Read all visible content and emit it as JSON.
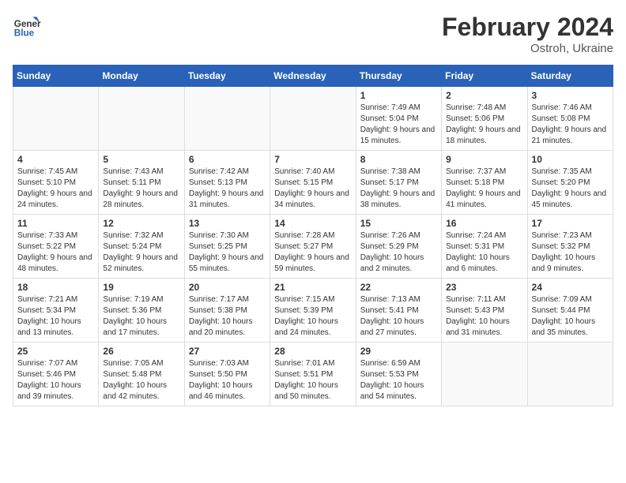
{
  "header": {
    "logo_general": "General",
    "logo_blue": "Blue",
    "month_title": "February 2024",
    "location": "Ostroh, Ukraine"
  },
  "weekdays": [
    "Sunday",
    "Monday",
    "Tuesday",
    "Wednesday",
    "Thursday",
    "Friday",
    "Saturday"
  ],
  "weeks": [
    [
      {
        "day": "",
        "sunrise": "",
        "sunset": "",
        "daylight": ""
      },
      {
        "day": "",
        "sunrise": "",
        "sunset": "",
        "daylight": ""
      },
      {
        "day": "",
        "sunrise": "",
        "sunset": "",
        "daylight": ""
      },
      {
        "day": "",
        "sunrise": "",
        "sunset": "",
        "daylight": ""
      },
      {
        "day": "1",
        "sunrise": "Sunrise: 7:49 AM",
        "sunset": "Sunset: 5:04 PM",
        "daylight": "Daylight: 9 hours and 15 minutes."
      },
      {
        "day": "2",
        "sunrise": "Sunrise: 7:48 AM",
        "sunset": "Sunset: 5:06 PM",
        "daylight": "Daylight: 9 hours and 18 minutes."
      },
      {
        "day": "3",
        "sunrise": "Sunrise: 7:46 AM",
        "sunset": "Sunset: 5:08 PM",
        "daylight": "Daylight: 9 hours and 21 minutes."
      }
    ],
    [
      {
        "day": "4",
        "sunrise": "Sunrise: 7:45 AM",
        "sunset": "Sunset: 5:10 PM",
        "daylight": "Daylight: 9 hours and 24 minutes."
      },
      {
        "day": "5",
        "sunrise": "Sunrise: 7:43 AM",
        "sunset": "Sunset: 5:11 PM",
        "daylight": "Daylight: 9 hours and 28 minutes."
      },
      {
        "day": "6",
        "sunrise": "Sunrise: 7:42 AM",
        "sunset": "Sunset: 5:13 PM",
        "daylight": "Daylight: 9 hours and 31 minutes."
      },
      {
        "day": "7",
        "sunrise": "Sunrise: 7:40 AM",
        "sunset": "Sunset: 5:15 PM",
        "daylight": "Daylight: 9 hours and 34 minutes."
      },
      {
        "day": "8",
        "sunrise": "Sunrise: 7:38 AM",
        "sunset": "Sunset: 5:17 PM",
        "daylight": "Daylight: 9 hours and 38 minutes."
      },
      {
        "day": "9",
        "sunrise": "Sunrise: 7:37 AM",
        "sunset": "Sunset: 5:18 PM",
        "daylight": "Daylight: 9 hours and 41 minutes."
      },
      {
        "day": "10",
        "sunrise": "Sunrise: 7:35 AM",
        "sunset": "Sunset: 5:20 PM",
        "daylight": "Daylight: 9 hours and 45 minutes."
      }
    ],
    [
      {
        "day": "11",
        "sunrise": "Sunrise: 7:33 AM",
        "sunset": "Sunset: 5:22 PM",
        "daylight": "Daylight: 9 hours and 48 minutes."
      },
      {
        "day": "12",
        "sunrise": "Sunrise: 7:32 AM",
        "sunset": "Sunset: 5:24 PM",
        "daylight": "Daylight: 9 hours and 52 minutes."
      },
      {
        "day": "13",
        "sunrise": "Sunrise: 7:30 AM",
        "sunset": "Sunset: 5:25 PM",
        "daylight": "Daylight: 9 hours and 55 minutes."
      },
      {
        "day": "14",
        "sunrise": "Sunrise: 7:28 AM",
        "sunset": "Sunset: 5:27 PM",
        "daylight": "Daylight: 9 hours and 59 minutes."
      },
      {
        "day": "15",
        "sunrise": "Sunrise: 7:26 AM",
        "sunset": "Sunset: 5:29 PM",
        "daylight": "Daylight: 10 hours and 2 minutes."
      },
      {
        "day": "16",
        "sunrise": "Sunrise: 7:24 AM",
        "sunset": "Sunset: 5:31 PM",
        "daylight": "Daylight: 10 hours and 6 minutes."
      },
      {
        "day": "17",
        "sunrise": "Sunrise: 7:23 AM",
        "sunset": "Sunset: 5:32 PM",
        "daylight": "Daylight: 10 hours and 9 minutes."
      }
    ],
    [
      {
        "day": "18",
        "sunrise": "Sunrise: 7:21 AM",
        "sunset": "Sunset: 5:34 PM",
        "daylight": "Daylight: 10 hours and 13 minutes."
      },
      {
        "day": "19",
        "sunrise": "Sunrise: 7:19 AM",
        "sunset": "Sunset: 5:36 PM",
        "daylight": "Daylight: 10 hours and 17 minutes."
      },
      {
        "day": "20",
        "sunrise": "Sunrise: 7:17 AM",
        "sunset": "Sunset: 5:38 PM",
        "daylight": "Daylight: 10 hours and 20 minutes."
      },
      {
        "day": "21",
        "sunrise": "Sunrise: 7:15 AM",
        "sunset": "Sunset: 5:39 PM",
        "daylight": "Daylight: 10 hours and 24 minutes."
      },
      {
        "day": "22",
        "sunrise": "Sunrise: 7:13 AM",
        "sunset": "Sunset: 5:41 PM",
        "daylight": "Daylight: 10 hours and 27 minutes."
      },
      {
        "day": "23",
        "sunrise": "Sunrise: 7:11 AM",
        "sunset": "Sunset: 5:43 PM",
        "daylight": "Daylight: 10 hours and 31 minutes."
      },
      {
        "day": "24",
        "sunrise": "Sunrise: 7:09 AM",
        "sunset": "Sunset: 5:44 PM",
        "daylight": "Daylight: 10 hours and 35 minutes."
      }
    ],
    [
      {
        "day": "25",
        "sunrise": "Sunrise: 7:07 AM",
        "sunset": "Sunset: 5:46 PM",
        "daylight": "Daylight: 10 hours and 39 minutes."
      },
      {
        "day": "26",
        "sunrise": "Sunrise: 7:05 AM",
        "sunset": "Sunset: 5:48 PM",
        "daylight": "Daylight: 10 hours and 42 minutes."
      },
      {
        "day": "27",
        "sunrise": "Sunrise: 7:03 AM",
        "sunset": "Sunset: 5:50 PM",
        "daylight": "Daylight: 10 hours and 46 minutes."
      },
      {
        "day": "28",
        "sunrise": "Sunrise: 7:01 AM",
        "sunset": "Sunset: 5:51 PM",
        "daylight": "Daylight: 10 hours and 50 minutes."
      },
      {
        "day": "29",
        "sunrise": "Sunrise: 6:59 AM",
        "sunset": "Sunset: 5:53 PM",
        "daylight": "Daylight: 10 hours and 54 minutes."
      },
      {
        "day": "",
        "sunrise": "",
        "sunset": "",
        "daylight": ""
      },
      {
        "day": "",
        "sunrise": "",
        "sunset": "",
        "daylight": ""
      }
    ]
  ]
}
